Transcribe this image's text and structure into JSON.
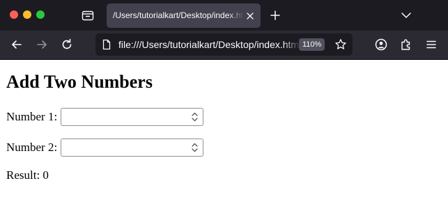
{
  "browser": {
    "tab": {
      "title": "/Users/tutorialkart/Desktop/index.html"
    },
    "address_bar": {
      "url": "file:///Users/tutorialkart/Desktop/index.html",
      "zoom": "110%"
    }
  },
  "page": {
    "heading": "Add Two Numbers",
    "fields": [
      {
        "label": "Number 1:",
        "value": ""
      },
      {
        "label": "Number 2:",
        "value": ""
      }
    ],
    "result": {
      "label": "Result:",
      "value": "0"
    }
  },
  "colors": {
    "tabstrip_bg": "#1c1b22",
    "active_tab_bg": "#42414d",
    "toolbar_bg": "#2b2a33",
    "urlbar_bg": "#1c1b22",
    "close_red": "#fe5f57",
    "minimize_yellow": "#febc2e",
    "zoom_green": "#28c840"
  }
}
